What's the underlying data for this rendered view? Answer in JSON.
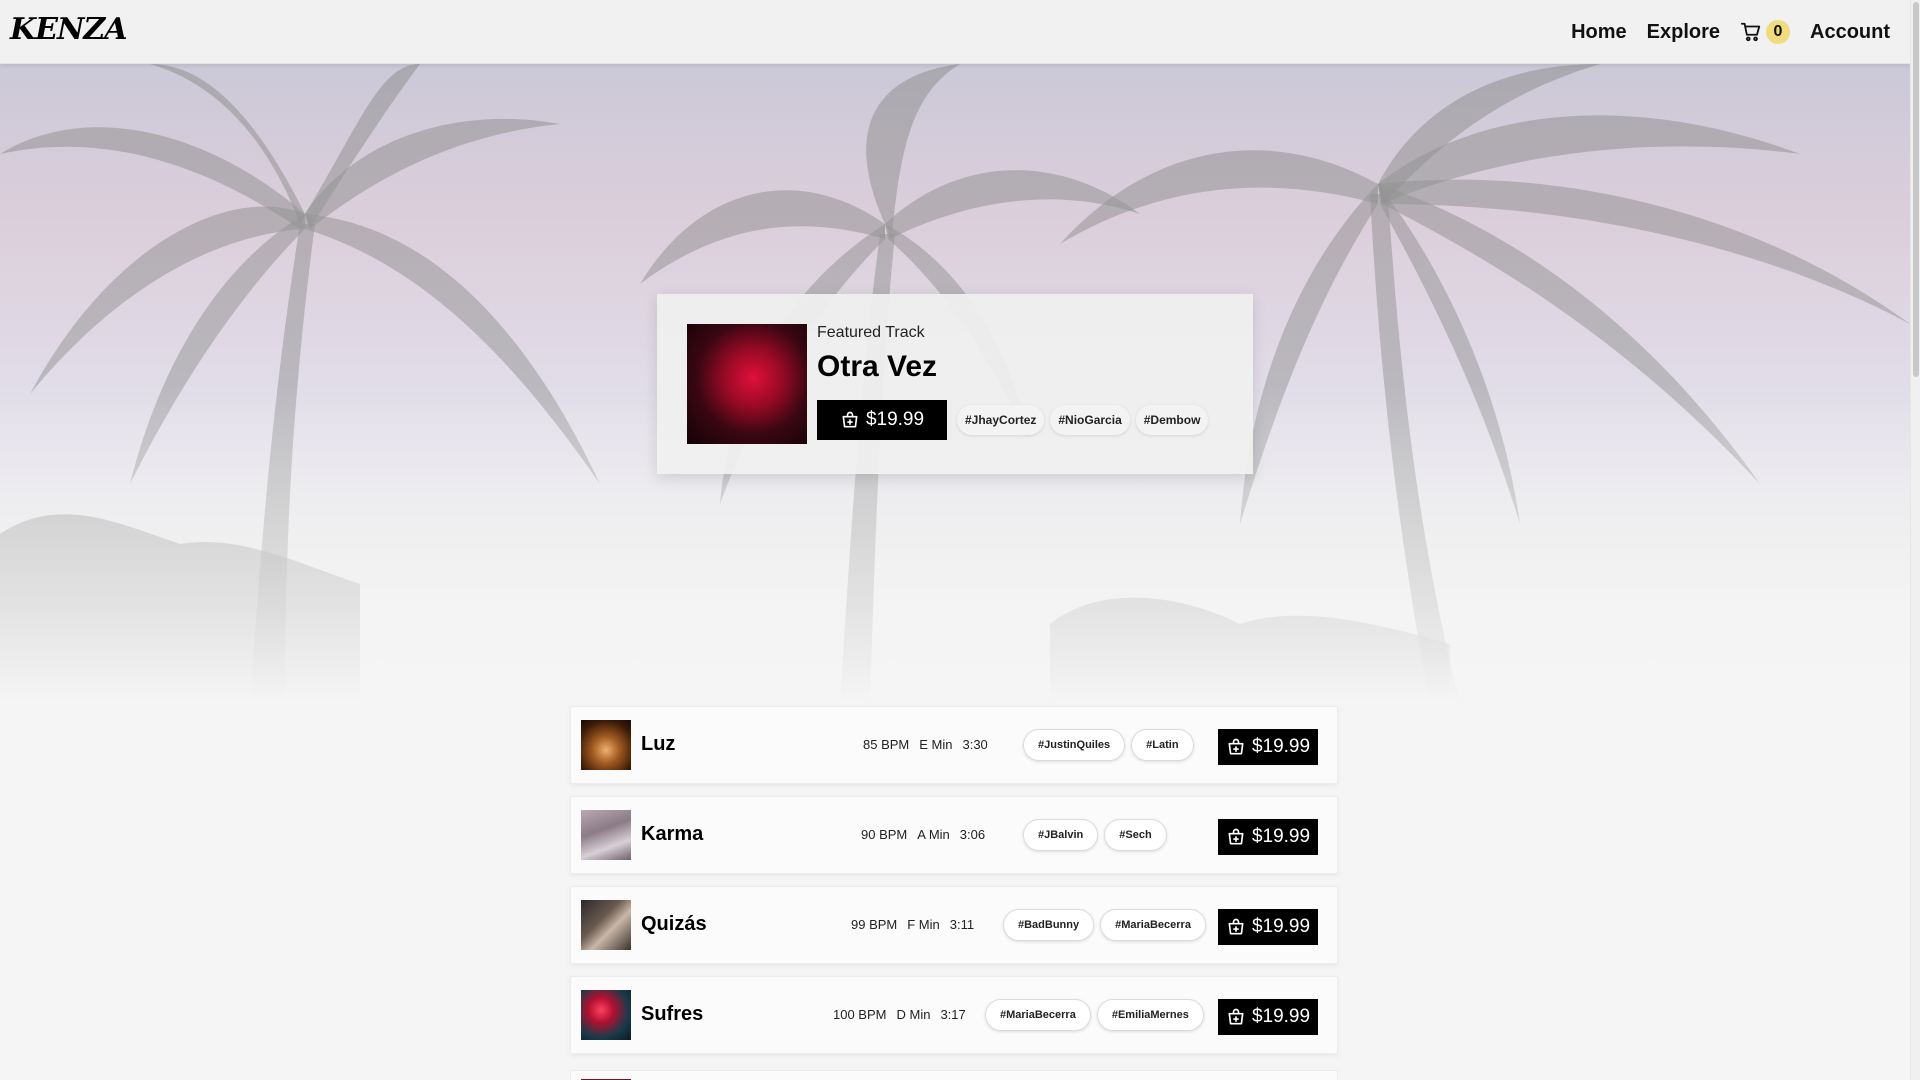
{
  "header": {
    "logo": "KENZA",
    "nav": {
      "home": "Home",
      "explore": "Explore",
      "account": "Account"
    },
    "cart": {
      "icon": "cart-icon",
      "count": "0"
    }
  },
  "featured": {
    "label": "Featured Track",
    "title": "Otra Vez",
    "price": "$19.99",
    "tags": [
      "#JhayCortez",
      "#NioGarcia",
      "#Dembow"
    ]
  },
  "tracks": [
    {
      "title": "Luz",
      "bpm": "85 BPM",
      "key": "E Min",
      "duration": "3:30",
      "tags": [
        "#JustinQuiles",
        "#Latin"
      ],
      "price": "$19.99"
    },
    {
      "title": "Karma",
      "bpm": "90 BPM",
      "key": "A Min",
      "duration": "3:06",
      "tags": [
        "#JBalvin",
        "#Sech"
      ],
      "price": "$19.99"
    },
    {
      "title": "Quizás",
      "bpm": "99 BPM",
      "key": "F Min",
      "duration": "3:11",
      "tags": [
        "#BadBunny",
        "#MariaBecerra"
      ],
      "price": "$19.99"
    },
    {
      "title": "Sufres",
      "bpm": "100 BPM",
      "key": "D Min",
      "duration": "3:17",
      "tags": [
        "#MariaBecerra",
        "#EmiliaMernes"
      ],
      "price": "$19.99"
    }
  ],
  "colors": {
    "accent": "#000000",
    "badge": "#f0dc7c",
    "background": "#f5f5f5"
  }
}
